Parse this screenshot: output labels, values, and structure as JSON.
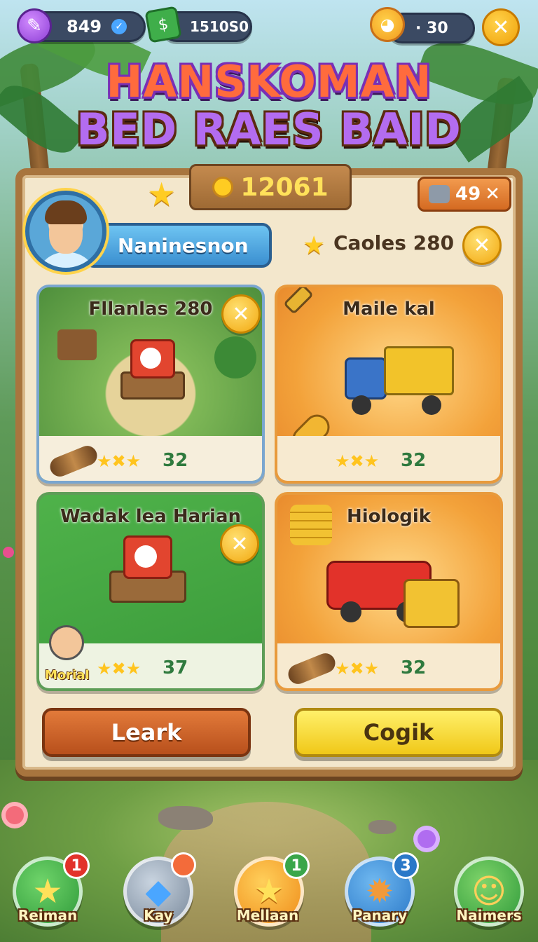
{
  "hud": {
    "gems": "849",
    "cash": "1510S0",
    "lives": "· 30",
    "icons": [
      "pencil-icon",
      "check-icon",
      "banknote-icon",
      "chick-icon",
      "close-icon"
    ]
  },
  "title": {
    "line1": [
      "HANS",
      "KOMAN",
      "",
      ""
    ],
    "line1_full": "HANSKOMAN",
    "line2": "BED RAES BAID"
  },
  "board": {
    "score": "12061",
    "tickets": "49",
    "player_name": "Naninesnon",
    "sub_score": "Caoles 280",
    "cards": [
      {
        "title": "Fllanlas 280",
        "count": "32",
        "theme": "village",
        "border": "#7aa6cf",
        "has_close": true
      },
      {
        "title": "Maile kal",
        "count": "32",
        "theme": "truck-yellow",
        "border": "#e89a3c",
        "has_close": false
      },
      {
        "title": "Wadak lea Harian",
        "count": "37",
        "theme": "green",
        "border": "#5e9d57",
        "has_close": true,
        "badge": "Morial"
      },
      {
        "title": "Hiologik",
        "count": "32",
        "theme": "truck-red",
        "border": "#e89a3c",
        "has_close": false
      }
    ],
    "left_button": "Leark",
    "right_button": "Cogik"
  },
  "nav": [
    {
      "label": "Reiman",
      "badge": "1",
      "icon": "star-icon",
      "color": "#2fa84a"
    },
    {
      "label": "Kay",
      "badge": "",
      "icon": "crystal-icon",
      "color": "#8a9bb0"
    },
    {
      "label": "Mellaan",
      "badge": "1",
      "icon": "star-icon",
      "color": "#f29a1e"
    },
    {
      "label": "Panary",
      "badge": "3",
      "icon": "sun-creature-icon",
      "color": "#2f8fd8"
    },
    {
      "label": "Naimers",
      "badge": "",
      "icon": "lion-icon",
      "color": "#3aa64a"
    }
  ],
  "colors": {
    "board_wood": "#a8753e",
    "parchment": "#f3e7cc",
    "gold": "#ffcc22",
    "left_button": "#c65a22",
    "right_button": "#f5d928"
  }
}
